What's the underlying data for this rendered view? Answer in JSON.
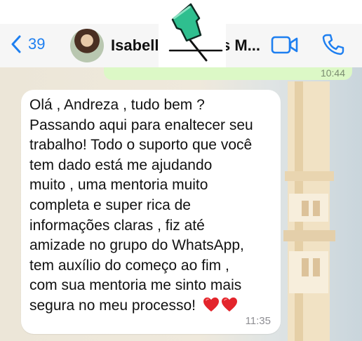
{
  "header": {
    "back_count": "39",
    "contact_name": "Isabella",
    "contact_name_rest": "s M..."
  },
  "chat": {
    "sent_time": "10:44",
    "message_lines": [
      "Olá , Andreza , tudo bem ?",
      "Passando aqui para enaltecer seu",
      "trabalho! Todo o suporto que você",
      "tem dado está me ajudando",
      "muito , uma mentoria muito",
      "completa e super rica de",
      "informações claras , fiz até",
      "amizade no grupo do WhatsApp,",
      "tem auxílio do começo ao fim ,",
      "com sua mentoria me sinto mais",
      "segura no meu processo!"
    ],
    "message_emoji": [
      "red-heart-icon",
      "red-heart-icon"
    ],
    "message_time": "11:35"
  },
  "colors": {
    "accent": "#1e7ff0",
    "sent_bubble": "#dcf8c6",
    "received_bubble": "#ffffff",
    "pin": "#2fbf8f"
  }
}
